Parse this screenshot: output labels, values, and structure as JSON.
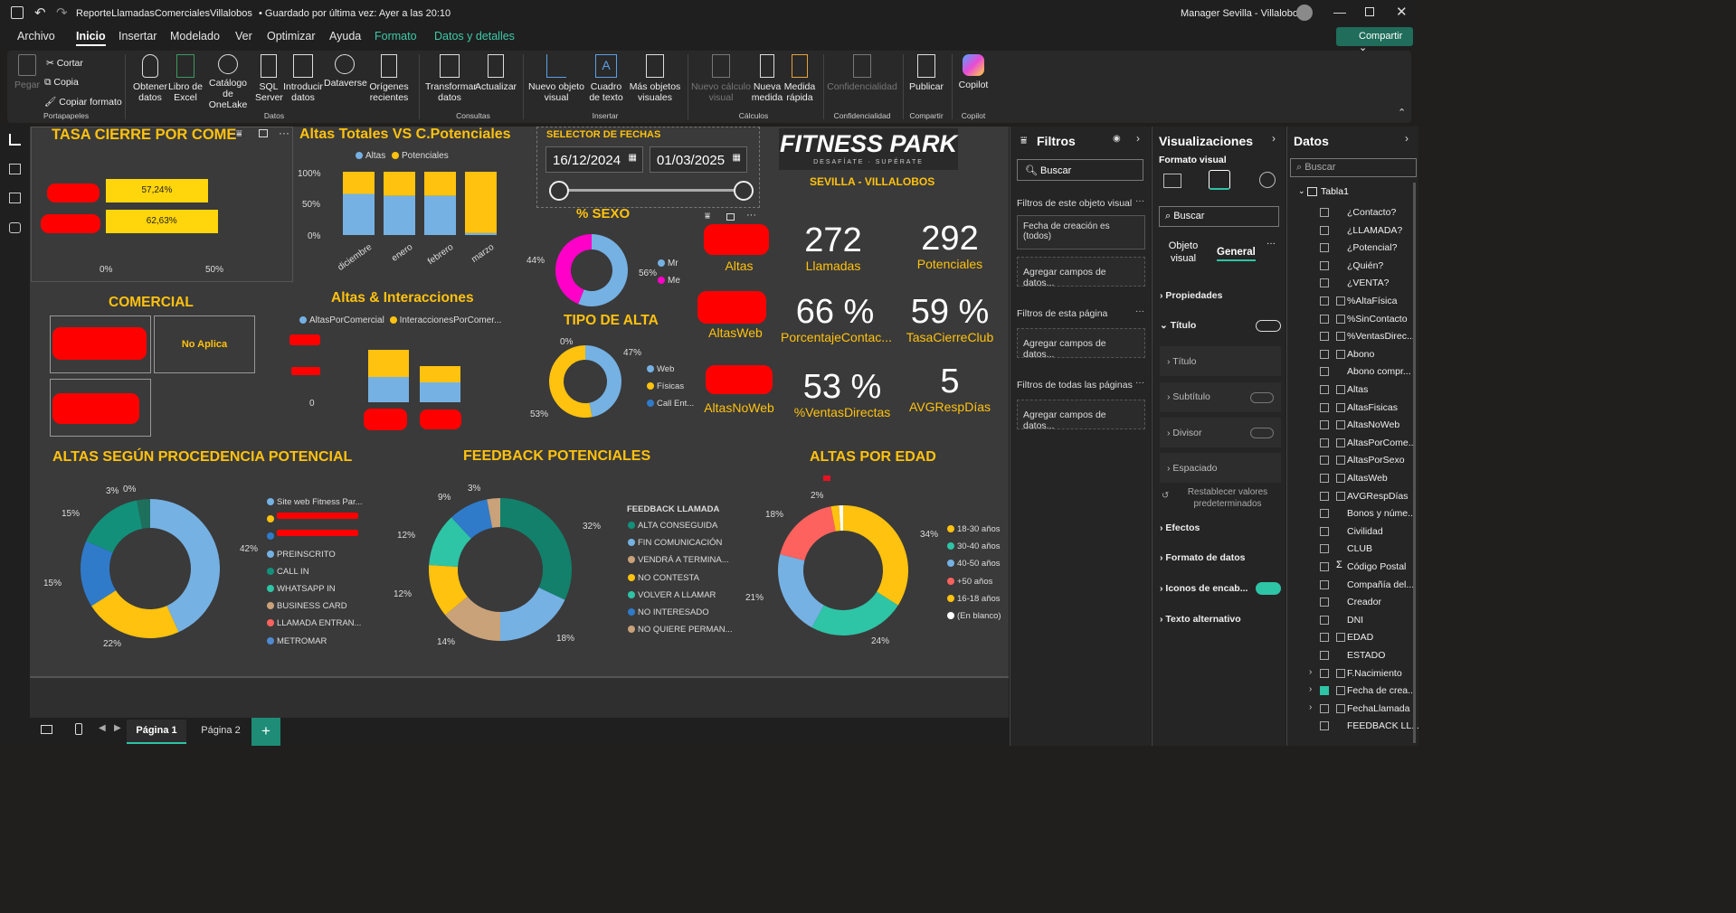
{
  "titlebar": {
    "file": "ReporteLlamadasComercialesVillalobos",
    "saved": "• Guardado por última vez: Ayer a las 20:10",
    "user": "Manager Sevilla - Villalobos"
  },
  "menu": [
    "Archivo",
    "Inicio",
    "Insertar",
    "Modelado",
    "Ver",
    "Optimizar",
    "Ayuda",
    "Formato",
    "Datos y detalles"
  ],
  "share": "Compartir",
  "ribbon": {
    "items": [
      "Pegar",
      "Cortar",
      "Copia",
      "Copiar formato",
      "Obtener datos",
      "Libro de Excel",
      "Catálogo de OneLake",
      "SQL Server",
      "Introducir datos",
      "Dataverse",
      "Orígenes recientes",
      "Transformar datos",
      "Actualizar",
      "Nuevo objeto visual",
      "Cuadro de texto",
      "Más objetos visuales",
      "Nuevo cálculo visual",
      "Nueva medida",
      "Medida rápida",
      "Confidencialidad",
      "Publicar",
      "Copilot"
    ],
    "groups": [
      "Portapapeles",
      "Datos",
      "Consultas",
      "Insertar",
      "Cálculos",
      "Confidencialidad",
      "Compartir",
      "Copilot"
    ]
  },
  "report": {
    "tasa_title": "TASA CIERRE POR COMER",
    "tasa": {
      "values": [
        57.24,
        62.63
      ],
      "labels": [
        "57,24%",
        "62,63%"
      ],
      "ticks": [
        "0%",
        "50%"
      ]
    },
    "altas_totales": {
      "title": "Altas Totales VS C.Potenciales",
      "legend": [
        "Altas",
        "Potenciales"
      ],
      "ticks": [
        "100%",
        "50%",
        "0%"
      ],
      "categories": [
        "diciembre",
        "enero",
        "febrero",
        "marzo"
      ],
      "altas_share": [
        0.65,
        0.62,
        0.62,
        0.03
      ]
    },
    "selector": {
      "title": "SELECTOR DE FECHAS",
      "from": "16/12/2024",
      "to": "01/03/2025"
    },
    "logo": {
      "brand": "FITNESS PARK",
      "tag": "DESAFÍATE · SUPÉRATE",
      "location": "SEVILLA - VILLALOBOS"
    },
    "sexo": {
      "title": "% SEXO",
      "legend": [
        "Mr",
        "Me"
      ],
      "values": [
        56,
        44
      ],
      "labels": [
        "44%",
        "56%"
      ]
    },
    "comercial": {
      "title": "COMERCIAL",
      "na": "No Aplica"
    },
    "altas_inter": {
      "title": "Altas & Interacciones",
      "legend": [
        "AltasPorComercial",
        "InteraccionesPorComer..."
      ],
      "zero": "0"
    },
    "tipo_alta": {
      "title": "TIPO DE ALTA",
      "legend": [
        "Web",
        "Físicas",
        "Call Ent..."
      ],
      "values": [
        47,
        53,
        0
      ],
      "labels": [
        "0%",
        "47%",
        "53%"
      ]
    },
    "kpis": [
      {
        "value": "",
        "label": "Altas"
      },
      {
        "value": "272",
        "label": "Llamadas"
      },
      {
        "value": "292",
        "label": "Potenciales"
      },
      {
        "value": "",
        "label": "AltasWeb"
      },
      {
        "value": "66 %",
        "label": "PorcentajeContac..."
      },
      {
        "value": "59 %",
        "label": "TasaCierreClub"
      },
      {
        "value": "",
        "label": "AltasNoWeb"
      },
      {
        "value": "53 %",
        "label": "%VentasDirectas"
      },
      {
        "value": "5",
        "label": "AVGRespDías"
      }
    ],
    "procedencia": {
      "title": "ALTAS SEGÚN PROCEDENCIA POTENCIAL",
      "legend": [
        "Site web Fitness Par...",
        "",
        "",
        "PREINSCRITO",
        "CALL IN",
        "WHATSAPP IN",
        "BUSINESS CARD",
        "LLAMADA ENTRAN...",
        "METROMAR"
      ],
      "values": [
        42,
        22,
        15,
        15,
        3,
        0
      ],
      "labels": [
        "42%",
        "22%",
        "15%",
        "15%",
        "3%",
        "0%"
      ]
    },
    "feedback": {
      "title": "FEEDBACK POTENCIALES",
      "legend_title": "FEEDBACK LLAMADA",
      "legend": [
        "ALTA CONSEGUIDA",
        "FIN COMUNICACIÓN",
        "VENDRÁ A TERMINA...",
        "NO CONTESTA",
        "VOLVER A LLAMAR",
        "NO INTERESADO",
        "NO QUIERE PERMAN..."
      ],
      "values": [
        32,
        18,
        14,
        12,
        12,
        9,
        3
      ],
      "labels": [
        "32%",
        "18%",
        "14%",
        "12%",
        "12%",
        "9%",
        "3%"
      ]
    },
    "edad": {
      "title": "ALTAS POR EDAD",
      "legend": [
        "18-30 años",
        "30-40 años",
        "40-50 años",
        "+50 años",
        "16-18 años",
        "(En blanco)"
      ],
      "values": [
        34,
        24,
        21,
        18,
        2,
        1
      ],
      "labels": [
        "34%",
        "24%",
        "21%",
        "18%",
        "2%"
      ]
    }
  },
  "pages": [
    "Página 1",
    "Página 2"
  ],
  "filtros": {
    "title": "Filtros",
    "search": "Buscar",
    "visual_section": "Filtros de este objeto visual",
    "visual_filter": "Fecha de creación es (todos)",
    "add": "Agregar campos de datos...",
    "page_section": "Filtros de esta página",
    "all_section": "Filtros de todas las páginas"
  },
  "viz": {
    "title": "Visualizaciones",
    "sub": "Formato visual",
    "search": "Buscar",
    "tab1": "Objeto visual",
    "tab2": "General",
    "rows": [
      "Propiedades",
      "Título",
      "Título",
      "Subtítulo",
      "Divisor",
      "Espaciado",
      "Restablecer valores predeterminados",
      "Efectos",
      "Formato de datos",
      "Iconos de encab...",
      "Texto alternativo"
    ]
  },
  "datos": {
    "title": "Datos",
    "search": "Buscar",
    "table": "Tabla1",
    "fields": [
      "¿Contacto?",
      "¿LLAMADA?",
      "¿Potencial?",
      "¿Quién?",
      "¿VENTA?",
      "%AltaFísica",
      "%SinContacto",
      "%VentasDirec...",
      "Abono",
      "Abono compr...",
      "Altas",
      "AltasFisicas",
      "AltasNoWeb",
      "AltasPorCome...",
      "AltasPorSexo",
      "AltasWeb",
      "AVGRespDías",
      "Bonos y núme...",
      "Civilidad",
      "CLUB",
      "Código Postal",
      "Compañía del...",
      "Creador",
      "DNI",
      "EDAD",
      "ESTADO",
      "F.Nacimiento",
      "Fecha de crea...",
      "FechaLlamada",
      "FEEDBACK LL..."
    ]
  },
  "colors": {
    "yellow": "#ffc20e",
    "lightblue": "#75b1e3",
    "blue": "#2f7ac9",
    "teal": "#12907a",
    "green": "#2ec4a6",
    "tan": "#c9a27a",
    "orange": "#fd625e",
    "magenta": "#ff00c8",
    "red": "#ff0000"
  }
}
